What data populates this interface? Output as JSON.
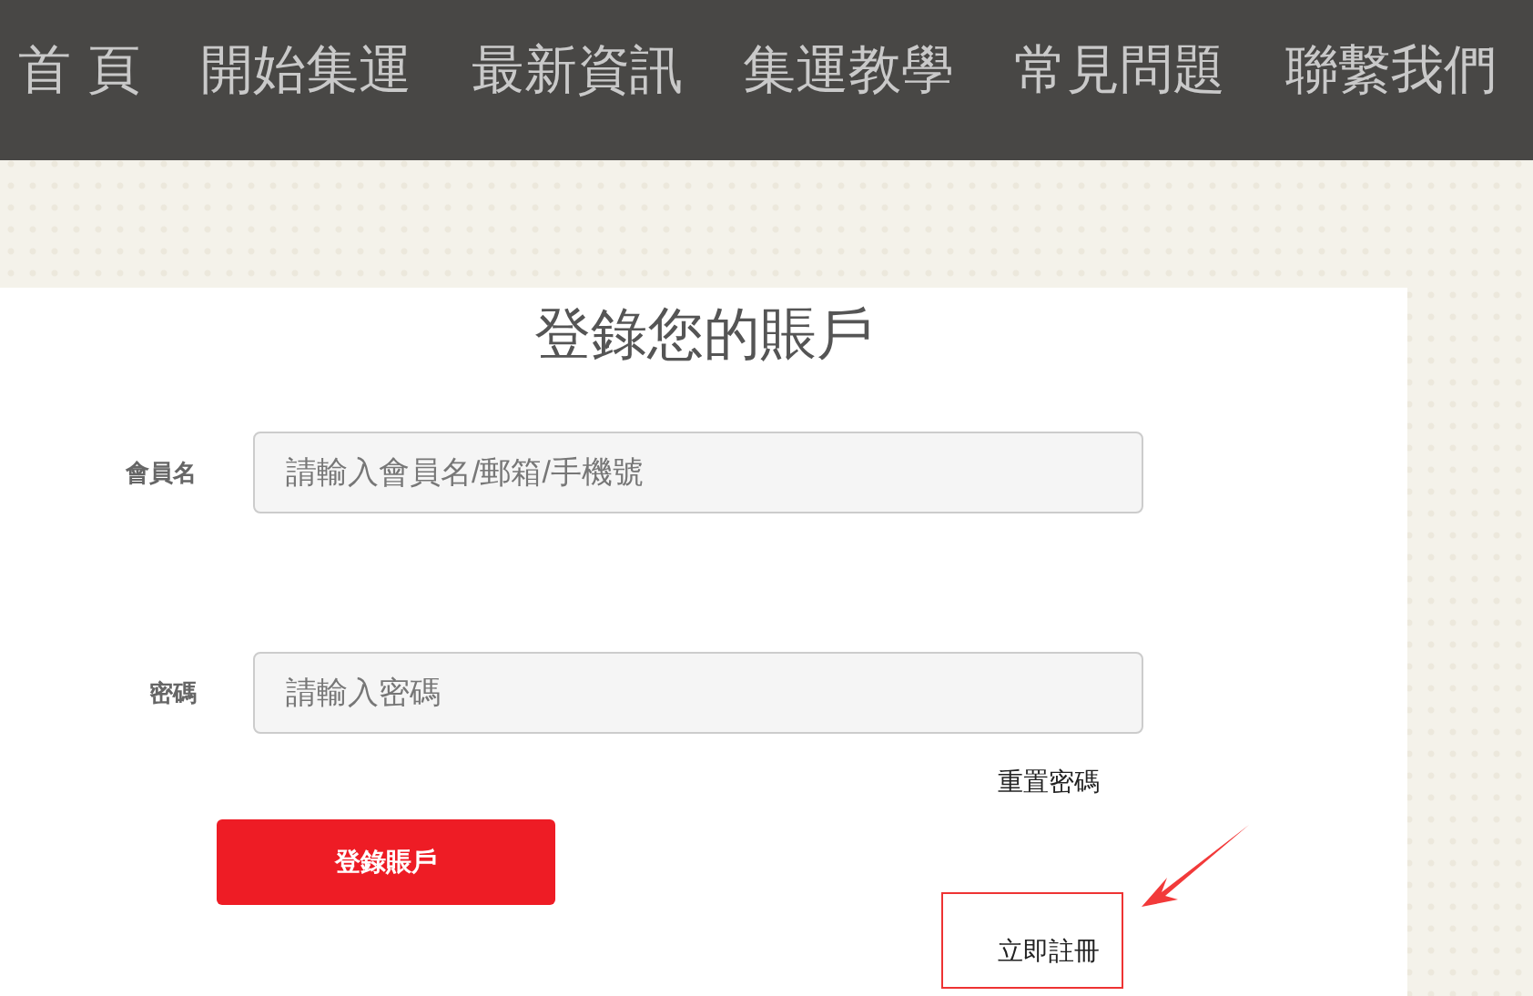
{
  "nav": {
    "items": [
      {
        "label": "首 頁"
      },
      {
        "label": "開始集運"
      },
      {
        "label": "最新資訊"
      },
      {
        "label": "集運教學"
      },
      {
        "label": "常見問題"
      },
      {
        "label": "聯繫我們"
      }
    ]
  },
  "login": {
    "title": "登錄您的賬戶",
    "fields": [
      {
        "label": "會員名",
        "placeholder": "請輸入會員名/郵箱/手機號"
      },
      {
        "label": "密碼",
        "placeholder": "請輸入密碼"
      }
    ],
    "reset_link": "重置密碼",
    "submit": "登錄賬戶",
    "register_link": "立即註冊"
  }
}
